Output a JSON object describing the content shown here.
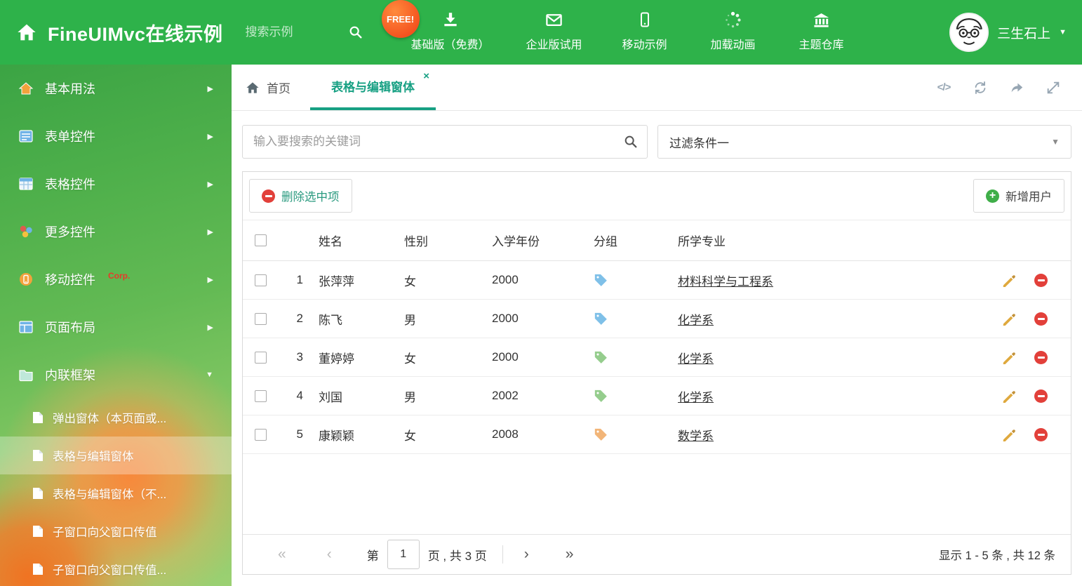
{
  "header": {
    "title": "FineUIMvc在线示例",
    "search_placeholder": "搜索示例",
    "free_badge": "FREE!",
    "nav": [
      {
        "label": "基础版（免费）"
      },
      {
        "label": "企业版试用"
      },
      {
        "label": "移动示例"
      },
      {
        "label": "加载动画"
      },
      {
        "label": "主题仓库"
      }
    ],
    "user_name": "三生石上"
  },
  "sidebar": {
    "items": [
      {
        "label": "基本用法"
      },
      {
        "label": "表单控件"
      },
      {
        "label": "表格控件"
      },
      {
        "label": "更多控件"
      },
      {
        "label": "移动控件",
        "badge": "Corp."
      },
      {
        "label": "页面布局"
      },
      {
        "label": "内联框架"
      }
    ],
    "subitems": [
      {
        "label": "弹出窗体（本页面或..."
      },
      {
        "label": "表格与编辑窗体"
      },
      {
        "label": "表格与编辑窗体（不..."
      },
      {
        "label": "子窗口向父窗口传值"
      },
      {
        "label": "子窗口向父窗口传值..."
      }
    ]
  },
  "tabbar": {
    "home_tab": "首页",
    "active_tab": "表格与编辑窗体",
    "close_glyph": "×",
    "code_glyph": "</>"
  },
  "filters": {
    "search_placeholder": "输入要搜索的关键词",
    "filter_value": "过滤条件一"
  },
  "toolbar": {
    "delete_label": "删除选中项",
    "add_label": "新增用户"
  },
  "table": {
    "columns": {
      "name": "姓名",
      "gender": "性别",
      "year": "入学年份",
      "group": "分组",
      "major": "所学专业"
    },
    "rows": [
      {
        "index": "1",
        "name": "张萍萍",
        "gender": "女",
        "year": "2000",
        "tag_color": "#7fc0e8",
        "major": "材料科学与工程系"
      },
      {
        "index": "2",
        "name": "陈飞",
        "gender": "男",
        "year": "2000",
        "tag_color": "#7fc0e8",
        "major": "化学系"
      },
      {
        "index": "3",
        "name": "董婷婷",
        "gender": "女",
        "year": "2000",
        "tag_color": "#95cd8d",
        "major": "化学系"
      },
      {
        "index": "4",
        "name": "刘国",
        "gender": "男",
        "year": "2002",
        "tag_color": "#95cd8d",
        "major": "化学系"
      },
      {
        "index": "5",
        "name": "康颖颖",
        "gender": "女",
        "year": "2008",
        "tag_color": "#f2b578",
        "major": "数学系"
      }
    ]
  },
  "pagination": {
    "prefix": "第",
    "page_value": "1",
    "suffix": "页 , 共 3 页",
    "summary": "显示 1 - 5 条 , 共 12 条",
    "first_glyph": "«",
    "prev_glyph": "‹",
    "next_glyph": "›",
    "last_glyph": "»"
  },
  "colors": {
    "header_green": "#2eb24a",
    "accent_teal": "#17a083",
    "free_badge_orange": "#f4511e",
    "delete_red": "#e2403a",
    "add_green": "#3fae49",
    "pencil_gold": "#dfa93e"
  }
}
